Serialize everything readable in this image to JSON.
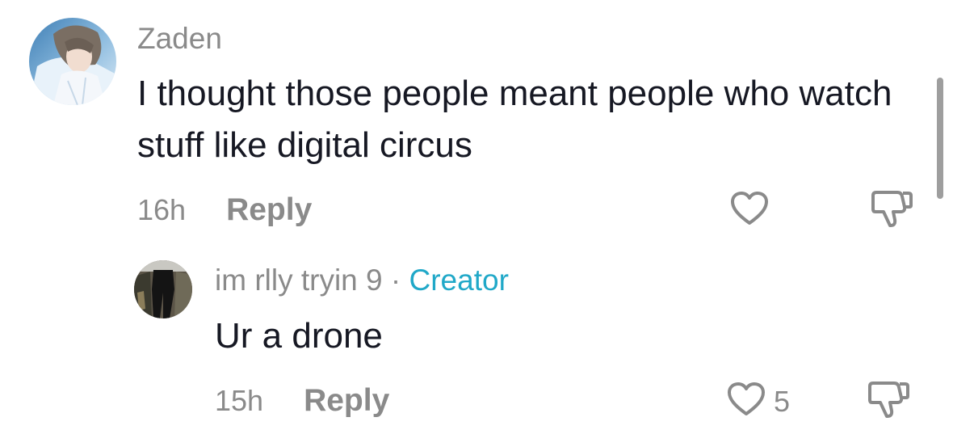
{
  "main_comment": {
    "username": "Zaden",
    "text": "I thought those people meant people who watch stuff like digital circus",
    "time": "16h",
    "reply_label": "Reply"
  },
  "reply_comment": {
    "username": "im rlly tryin 9",
    "separator": " · ",
    "creator_label": "Creator",
    "text": "Ur a drone",
    "time": "15h",
    "reply_label": "Reply",
    "like_count": "5"
  },
  "colors": {
    "username": "#8a8a8a",
    "body_text": "#161823",
    "creator_badge": "#20a8c8",
    "icon_gray": "#8a8a8a"
  },
  "icons": {
    "like": "heart-icon",
    "dislike": "thumbs-down-icon"
  }
}
